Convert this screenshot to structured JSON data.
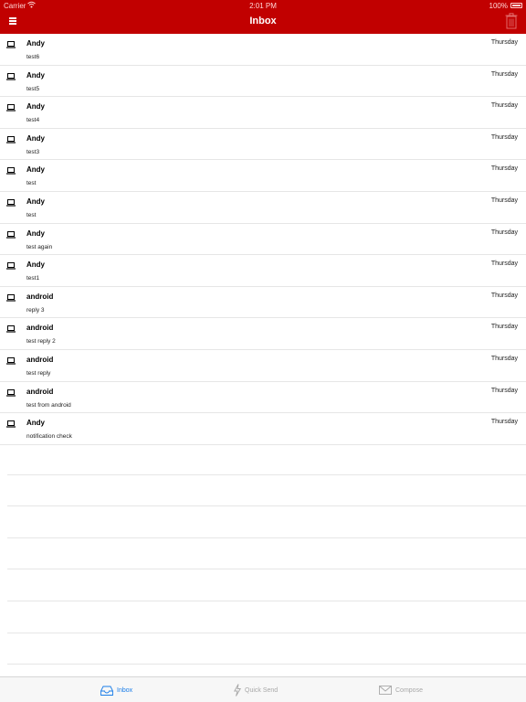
{
  "status_bar": {
    "carrier": "Carrier",
    "time": "2:01 PM",
    "battery": "100%"
  },
  "nav": {
    "title": "Inbox"
  },
  "messages": [
    {
      "sender": "Andy",
      "date": "Thursday",
      "subject": "test6"
    },
    {
      "sender": "Andy",
      "date": "Thursday",
      "subject": "test5"
    },
    {
      "sender": "Andy",
      "date": "Thursday",
      "subject": "test4"
    },
    {
      "sender": "Andy",
      "date": "Thursday",
      "subject": "test3"
    },
    {
      "sender": "Andy",
      "date": "Thursday",
      "subject": "test"
    },
    {
      "sender": "Andy",
      "date": "Thursday",
      "subject": "test"
    },
    {
      "sender": "Andy",
      "date": "Thursday",
      "subject": "test again"
    },
    {
      "sender": "Andy",
      "date": "Thursday",
      "subject": "test1"
    },
    {
      "sender": "android",
      "date": "Thursday",
      "subject": "reply 3"
    },
    {
      "sender": "android",
      "date": "Thursday",
      "subject": "test reply 2"
    },
    {
      "sender": "android",
      "date": "Thursday",
      "subject": "test reply"
    },
    {
      "sender": "android",
      "date": "Thursday",
      "subject": "test from android"
    },
    {
      "sender": "Andy",
      "date": "Thursday",
      "subject": "notification check"
    }
  ],
  "tabs": [
    {
      "label": "Inbox",
      "icon": "inbox-icon",
      "active": true
    },
    {
      "label": "Quick Send",
      "icon": "lightning-icon",
      "active": false
    },
    {
      "label": "Compose",
      "icon": "envelope-icon",
      "active": false
    }
  ],
  "colors": {
    "header": "#c10000",
    "active_tab": "#1a7de8",
    "inactive_tab": "#a8a8a8"
  }
}
